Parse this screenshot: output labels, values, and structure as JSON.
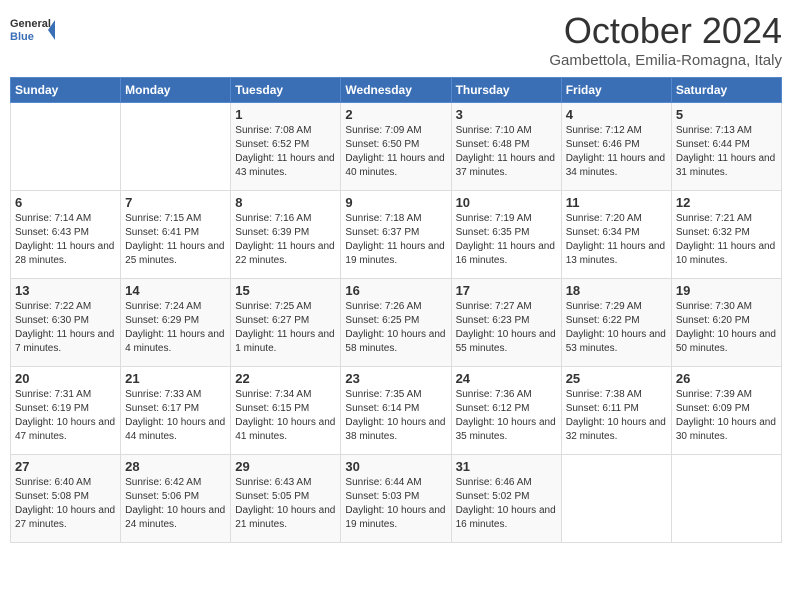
{
  "header": {
    "logo_general": "General",
    "logo_blue": "Blue",
    "month": "October 2024",
    "location": "Gambettola, Emilia-Romagna, Italy"
  },
  "days_of_week": [
    "Sunday",
    "Monday",
    "Tuesday",
    "Wednesday",
    "Thursday",
    "Friday",
    "Saturday"
  ],
  "weeks": [
    [
      {
        "day": "",
        "content": ""
      },
      {
        "day": "",
        "content": ""
      },
      {
        "day": "1",
        "content": "Sunrise: 7:08 AM\nSunset: 6:52 PM\nDaylight: 11 hours and 43 minutes."
      },
      {
        "day": "2",
        "content": "Sunrise: 7:09 AM\nSunset: 6:50 PM\nDaylight: 11 hours and 40 minutes."
      },
      {
        "day": "3",
        "content": "Sunrise: 7:10 AM\nSunset: 6:48 PM\nDaylight: 11 hours and 37 minutes."
      },
      {
        "day": "4",
        "content": "Sunrise: 7:12 AM\nSunset: 6:46 PM\nDaylight: 11 hours and 34 minutes."
      },
      {
        "day": "5",
        "content": "Sunrise: 7:13 AM\nSunset: 6:44 PM\nDaylight: 11 hours and 31 minutes."
      }
    ],
    [
      {
        "day": "6",
        "content": "Sunrise: 7:14 AM\nSunset: 6:43 PM\nDaylight: 11 hours and 28 minutes."
      },
      {
        "day": "7",
        "content": "Sunrise: 7:15 AM\nSunset: 6:41 PM\nDaylight: 11 hours and 25 minutes."
      },
      {
        "day": "8",
        "content": "Sunrise: 7:16 AM\nSunset: 6:39 PM\nDaylight: 11 hours and 22 minutes."
      },
      {
        "day": "9",
        "content": "Sunrise: 7:18 AM\nSunset: 6:37 PM\nDaylight: 11 hours and 19 minutes."
      },
      {
        "day": "10",
        "content": "Sunrise: 7:19 AM\nSunset: 6:35 PM\nDaylight: 11 hours and 16 minutes."
      },
      {
        "day": "11",
        "content": "Sunrise: 7:20 AM\nSunset: 6:34 PM\nDaylight: 11 hours and 13 minutes."
      },
      {
        "day": "12",
        "content": "Sunrise: 7:21 AM\nSunset: 6:32 PM\nDaylight: 11 hours and 10 minutes."
      }
    ],
    [
      {
        "day": "13",
        "content": "Sunrise: 7:22 AM\nSunset: 6:30 PM\nDaylight: 11 hours and 7 minutes."
      },
      {
        "day": "14",
        "content": "Sunrise: 7:24 AM\nSunset: 6:29 PM\nDaylight: 11 hours and 4 minutes."
      },
      {
        "day": "15",
        "content": "Sunrise: 7:25 AM\nSunset: 6:27 PM\nDaylight: 11 hours and 1 minute."
      },
      {
        "day": "16",
        "content": "Sunrise: 7:26 AM\nSunset: 6:25 PM\nDaylight: 10 hours and 58 minutes."
      },
      {
        "day": "17",
        "content": "Sunrise: 7:27 AM\nSunset: 6:23 PM\nDaylight: 10 hours and 55 minutes."
      },
      {
        "day": "18",
        "content": "Sunrise: 7:29 AM\nSunset: 6:22 PM\nDaylight: 10 hours and 53 minutes."
      },
      {
        "day": "19",
        "content": "Sunrise: 7:30 AM\nSunset: 6:20 PM\nDaylight: 10 hours and 50 minutes."
      }
    ],
    [
      {
        "day": "20",
        "content": "Sunrise: 7:31 AM\nSunset: 6:19 PM\nDaylight: 10 hours and 47 minutes."
      },
      {
        "day": "21",
        "content": "Sunrise: 7:33 AM\nSunset: 6:17 PM\nDaylight: 10 hours and 44 minutes."
      },
      {
        "day": "22",
        "content": "Sunrise: 7:34 AM\nSunset: 6:15 PM\nDaylight: 10 hours and 41 minutes."
      },
      {
        "day": "23",
        "content": "Sunrise: 7:35 AM\nSunset: 6:14 PM\nDaylight: 10 hours and 38 minutes."
      },
      {
        "day": "24",
        "content": "Sunrise: 7:36 AM\nSunset: 6:12 PM\nDaylight: 10 hours and 35 minutes."
      },
      {
        "day": "25",
        "content": "Sunrise: 7:38 AM\nSunset: 6:11 PM\nDaylight: 10 hours and 32 minutes."
      },
      {
        "day": "26",
        "content": "Sunrise: 7:39 AM\nSunset: 6:09 PM\nDaylight: 10 hours and 30 minutes."
      }
    ],
    [
      {
        "day": "27",
        "content": "Sunrise: 6:40 AM\nSunset: 5:08 PM\nDaylight: 10 hours and 27 minutes."
      },
      {
        "day": "28",
        "content": "Sunrise: 6:42 AM\nSunset: 5:06 PM\nDaylight: 10 hours and 24 minutes."
      },
      {
        "day": "29",
        "content": "Sunrise: 6:43 AM\nSunset: 5:05 PM\nDaylight: 10 hours and 21 minutes."
      },
      {
        "day": "30",
        "content": "Sunrise: 6:44 AM\nSunset: 5:03 PM\nDaylight: 10 hours and 19 minutes."
      },
      {
        "day": "31",
        "content": "Sunrise: 6:46 AM\nSunset: 5:02 PM\nDaylight: 10 hours and 16 minutes."
      },
      {
        "day": "",
        "content": ""
      },
      {
        "day": "",
        "content": ""
      }
    ]
  ]
}
